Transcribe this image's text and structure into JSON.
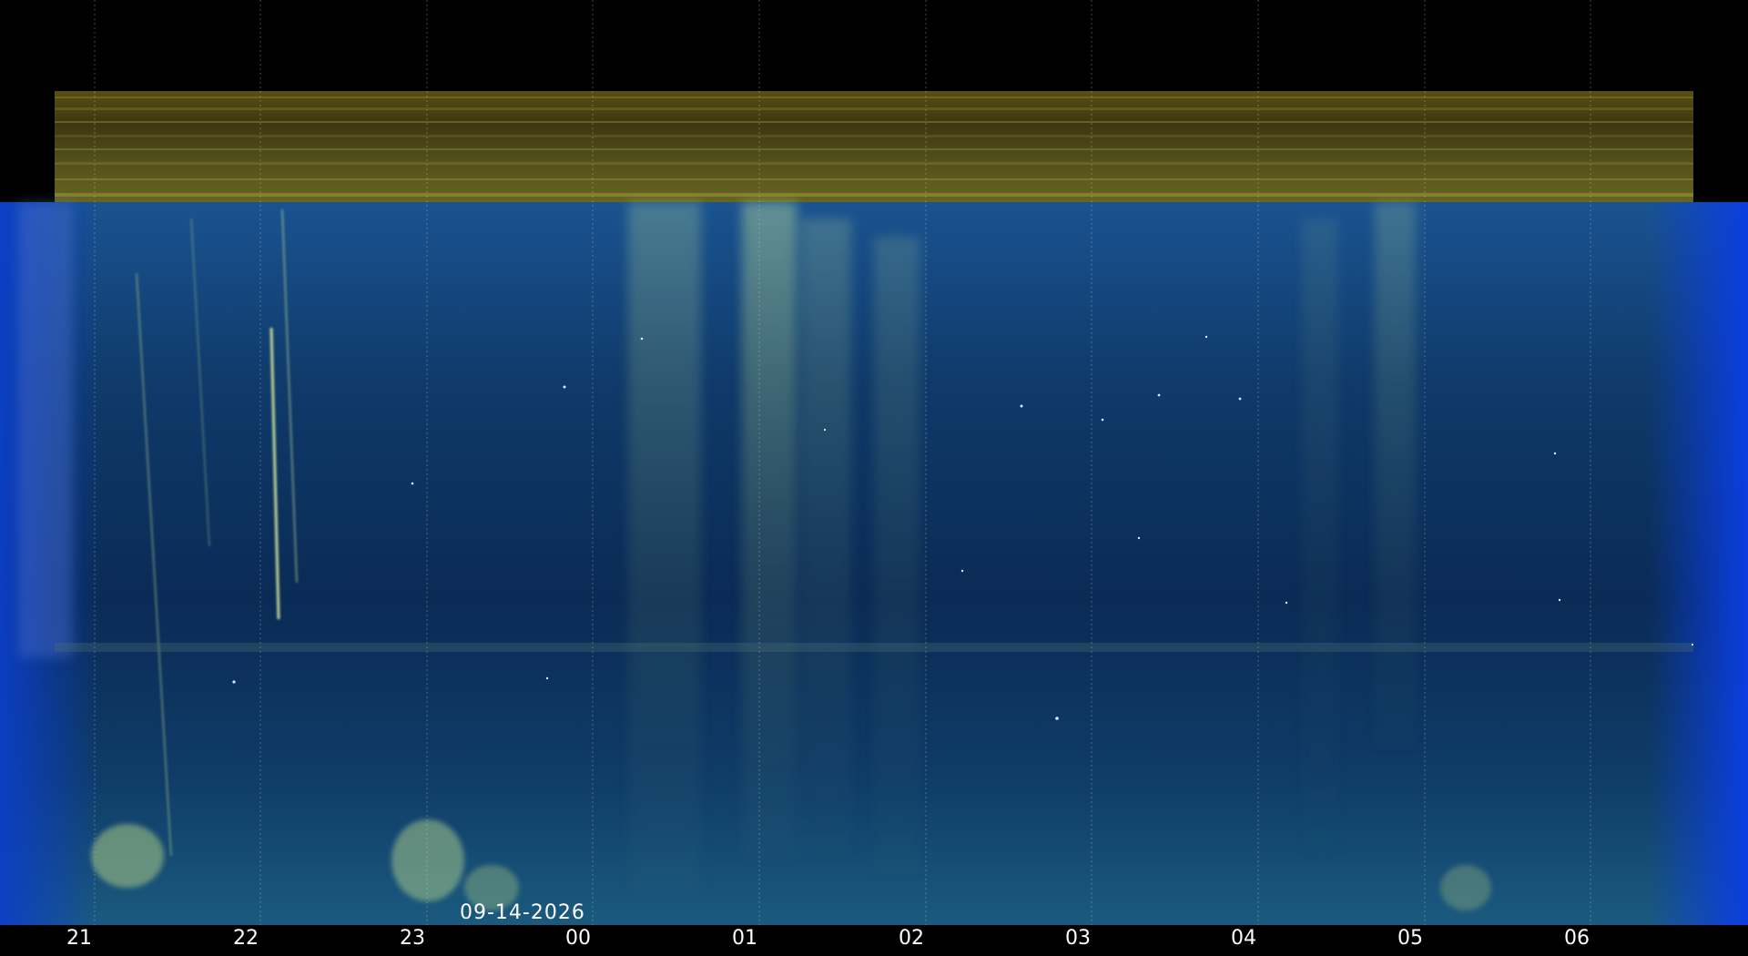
{
  "date": "09-14-2026",
  "hour_labels": [
    "21",
    "22",
    "23",
    "00",
    "01",
    "02",
    "03",
    "04",
    "05",
    "06"
  ],
  "colors": {
    "background": "#000000",
    "sky": "#0b2c55",
    "airglow_band": "#6f6a22",
    "aurora": "#a8c38f",
    "label": "#ffffff"
  }
}
